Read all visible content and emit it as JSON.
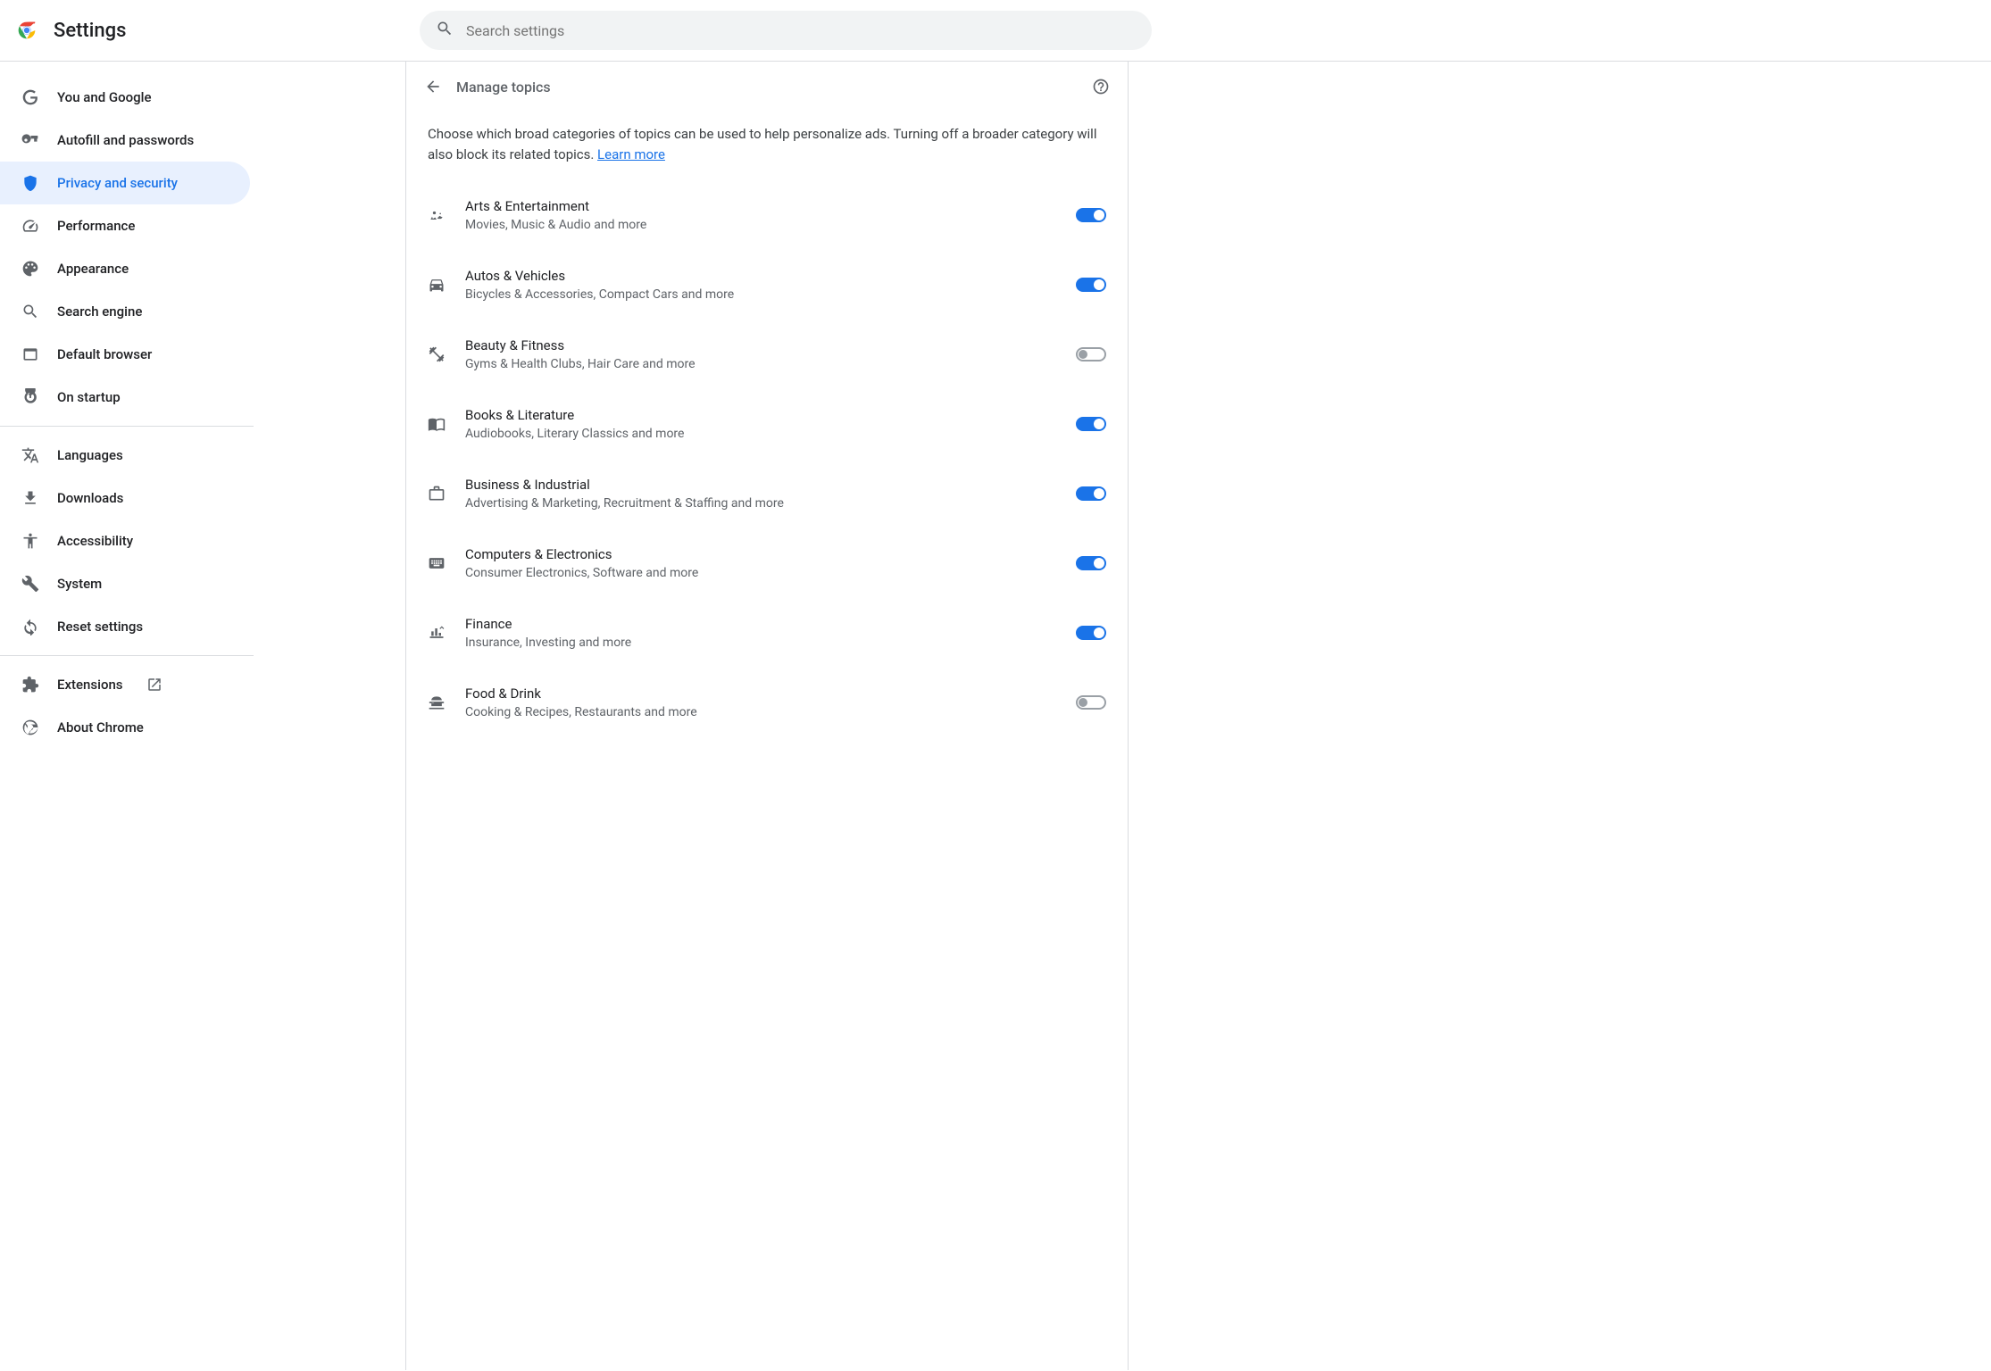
{
  "app_title": "Settings",
  "search": {
    "placeholder": "Search settings"
  },
  "sidebar": {
    "items": [
      {
        "label": "You and Google",
        "icon": "google",
        "active": false
      },
      {
        "label": "Autofill and passwords",
        "icon": "key",
        "active": false
      },
      {
        "label": "Privacy and security",
        "icon": "shield",
        "active": true
      },
      {
        "label": "Performance",
        "icon": "speed",
        "active": false
      },
      {
        "label": "Appearance",
        "icon": "palette",
        "active": false
      },
      {
        "label": "Search engine",
        "icon": "search",
        "active": false
      },
      {
        "label": "Default browser",
        "icon": "browser",
        "active": false
      },
      {
        "label": "On startup",
        "icon": "power",
        "active": false
      }
    ],
    "items2": [
      {
        "label": "Languages",
        "icon": "translate"
      },
      {
        "label": "Downloads",
        "icon": "download"
      },
      {
        "label": "Accessibility",
        "icon": "accessibility"
      },
      {
        "label": "System",
        "icon": "build"
      },
      {
        "label": "Reset settings",
        "icon": "reset"
      }
    ],
    "items3": [
      {
        "label": "Extensions",
        "icon": "extension",
        "external": true
      },
      {
        "label": "About Chrome",
        "icon": "chrome"
      }
    ]
  },
  "main": {
    "title": "Manage topics",
    "description_prefix": "Choose which broad categories of topics can be used to help personalize ads. Turning off a broader category will also block its related topics. ",
    "learn_more": "Learn more",
    "topics": [
      {
        "title": "Arts & Entertainment",
        "sub": "Movies, Music & Audio and more",
        "on": true,
        "icon": "arts"
      },
      {
        "title": "Autos & Vehicles",
        "sub": "Bicycles & Accessories, Compact Cars and more",
        "on": true,
        "icon": "car"
      },
      {
        "title": "Beauty & Fitness",
        "sub": "Gyms & Health Clubs, Hair Care and more",
        "on": false,
        "icon": "fitness"
      },
      {
        "title": "Books & Literature",
        "sub": "Audiobooks, Literary Classics and more",
        "on": true,
        "icon": "book"
      },
      {
        "title": "Business & Industrial",
        "sub": "Advertising & Marketing, Recruitment & Staffing and more",
        "on": true,
        "icon": "business"
      },
      {
        "title": "Computers & Electronics",
        "sub": "Consumer Electronics, Software and more",
        "on": true,
        "icon": "keyboard"
      },
      {
        "title": "Finance",
        "sub": "Insurance, Investing and more",
        "on": true,
        "icon": "finance"
      },
      {
        "title": "Food & Drink",
        "sub": "Cooking & Recipes, Restaurants and more",
        "on": false,
        "icon": "food"
      }
    ]
  }
}
